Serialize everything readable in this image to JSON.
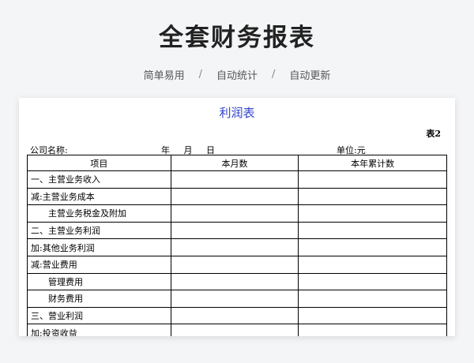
{
  "hero": {
    "title": "全套财务报表",
    "tags": [
      "简单易用",
      "自动统计",
      "自动更新"
    ],
    "separator": "/"
  },
  "sheet": {
    "title": "利润表",
    "table_no": "表2",
    "company_label": "公司名称:",
    "date_year": "年",
    "date_month": "月",
    "date_day": "日",
    "unit_label": "单位:元",
    "columns": [
      "项目",
      "本月数",
      "本年累计数"
    ],
    "rows": [
      {
        "label": "一、主营业务收入",
        "bold": false,
        "indent": 0
      },
      {
        "label": "减:主营业务成本",
        "bold": false,
        "indent": 0
      },
      {
        "label": "主营业务税金及附加",
        "bold": false,
        "indent": 1
      },
      {
        "label": "二、主营业务利润",
        "bold": true,
        "indent": 0
      },
      {
        "label": "加:其他业务利润",
        "bold": false,
        "indent": 0
      },
      {
        "label": "减:营业费用",
        "bold": false,
        "indent": 0
      },
      {
        "label": "管理费用",
        "bold": false,
        "indent": 1
      },
      {
        "label": "财务费用",
        "bold": false,
        "indent": 1
      },
      {
        "label": "三、营业利润",
        "bold": true,
        "indent": 0
      },
      {
        "label": "加:投资收益",
        "bold": false,
        "indent": 0
      }
    ]
  }
}
